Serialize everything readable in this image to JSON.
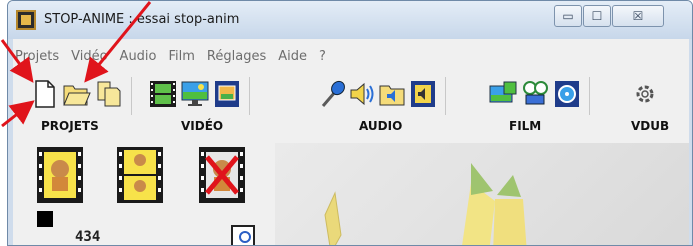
{
  "window": {
    "title": "STOP-ANIME : essai stop-anim",
    "controls": {
      "minimize": "▭",
      "maximize": "☐",
      "close": "☒"
    }
  },
  "menu": {
    "items": [
      "Projets",
      "Vidéo",
      "Audio",
      "Film",
      "Réglages",
      "Aide",
      "?"
    ]
  },
  "toolbar": {
    "groups": [
      {
        "label": "PROJETS",
        "buttons": [
          "new-file-icon",
          "open-folder-icon",
          "copy-files-icon"
        ]
      },
      {
        "label": "VIDÉO",
        "buttons": [
          "film-strip-icon",
          "monitor-landscape-icon",
          "film-frame-icon"
        ]
      },
      {
        "label": "AUDIO",
        "buttons": [
          "microphone-icon",
          "speaker-icon",
          "audio-folder-icon",
          "audio-film-icon"
        ]
      },
      {
        "label": "FILM",
        "buttons": [
          "film-landscape-icon",
          "film-projector-icon",
          "film-reel-icon"
        ]
      },
      {
        "label": "VDUB",
        "buttons": [
          "gear-icon"
        ]
      }
    ]
  },
  "content": {
    "thumbnails": [
      "film-character-icon",
      "film-character-double-icon",
      "film-character-deleted-icon"
    ],
    "counter": "434"
  },
  "colors": {
    "arrow": "#e0141b",
    "titlebar_top": "#e4edf7",
    "titlebar_bottom": "#c7d7ea",
    "menu_text": "#6d6d6d"
  }
}
